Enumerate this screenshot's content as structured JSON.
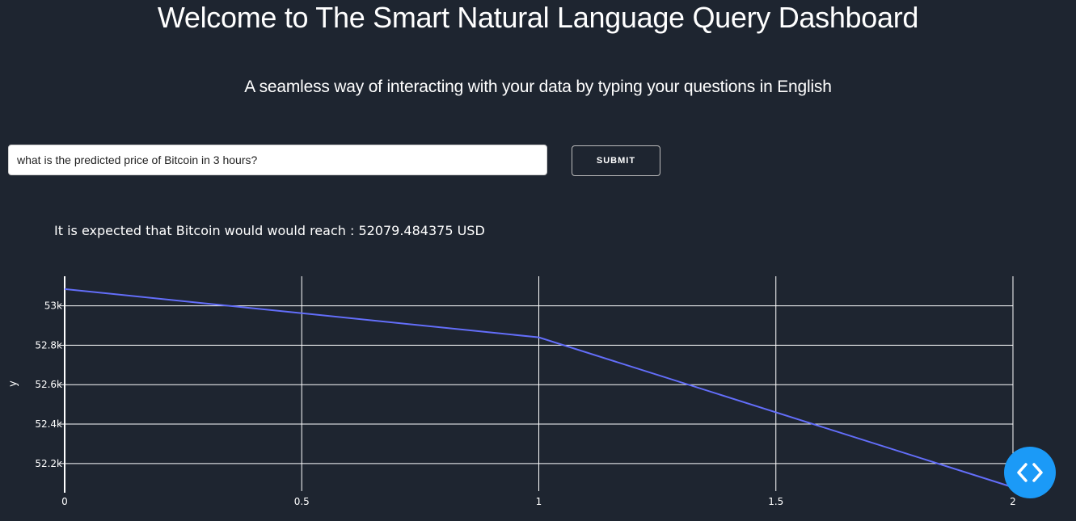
{
  "header": {
    "title": "Welcome to The Smart Natural Language Query Dashboard",
    "subtitle": "A seamless way of interacting with your data by typing your questions in English"
  },
  "query": {
    "value": "what is the predicted price of Bitcoin in 3 hours?",
    "submit_label": "SUBMIT"
  },
  "result": {
    "text": "It is expected that Bitcoin would would reach : 52079.484375 USD"
  },
  "colors": {
    "background": "#1e2530",
    "line": "#636efa",
    "grid": "#ffffff",
    "fab": "#1b9af7"
  },
  "fab": {
    "icon": "code-brackets-icon"
  },
  "chart_data": {
    "type": "line",
    "x": [
      0,
      1,
      2
    ],
    "series": [
      {
        "values": [
          53085,
          52840,
          52079.484375
        ]
      }
    ],
    "xlabel": "",
    "ylabel": "y",
    "xlim": [
      0,
      2
    ],
    "ylim": [
      52060,
      53150
    ],
    "xticks": [
      0,
      0.5,
      1,
      1.5,
      2
    ],
    "xtick_labels": [
      "0",
      "0.5",
      "1",
      "1.5",
      "2"
    ],
    "yticks": [
      52200,
      52400,
      52600,
      52800,
      53000
    ],
    "ytick_labels": [
      "52.2k",
      "52.4k",
      "52.6k",
      "52.8k",
      "53k"
    ],
    "grid": true,
    "legend": "none"
  }
}
